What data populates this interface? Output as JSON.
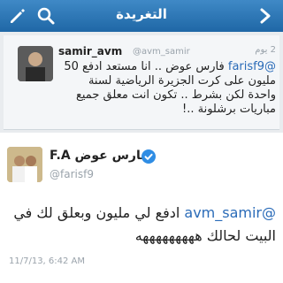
{
  "header": {
    "title": "التغريدة",
    "back_icon": "back-arrow-icon",
    "search_icon": "search-icon",
    "compose_icon": "compose-icon",
    "bg_color": "#2a74b5"
  },
  "quoted_tweet": {
    "name": "samir_avm",
    "handle": "@avm_samir",
    "time": "2 يوم",
    "mention": "@farisf9",
    "text": "فارس عوض .. انا مستعد ادفع 50 مليون على كرت الجزيرة الرياضية لسنة واحدة لكن بشرط .. تكون انت معلق جميع مباريات برشلونة ..!"
  },
  "main_tweet": {
    "name": "فارس عوض F.A",
    "handle": "@farisf9",
    "verified": true,
    "mention": "@avm_samir",
    "text": "ادفع لي مليون وبعلق لك في البيت لحالك هههههههههه",
    "date": "11/7/13, 6:42 AM"
  }
}
